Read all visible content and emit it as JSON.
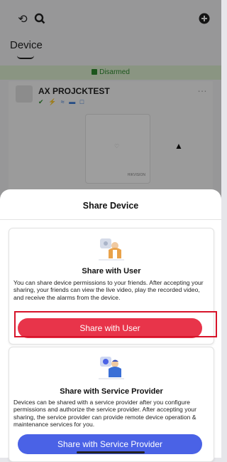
{
  "header": {
    "device_tab": "Device"
  },
  "arm_status": "Disarmed",
  "device": {
    "name": "AX PROJCKTEST",
    "brand": "HIKVISION"
  },
  "sheet": {
    "title": "Share Device",
    "user": {
      "title": "Share with User",
      "description": "You can share device permissions to your friends. After accepting your sharing, your friends can view the live video, play the recorded video, and receive the alarms from the device.",
      "button": "Share with User"
    },
    "provider": {
      "title": "Share with Service Provider",
      "description": "Devices can be shared with a service provider after you configure permissions and authorize the service provider. After accepting your sharing, the service provider can provide remote device operation & maintenance services for you.",
      "button": "Share with Service Provider"
    }
  },
  "colors": {
    "user_button": "#e8344a",
    "provider_button": "#4a62e6",
    "highlight": "#d7142a",
    "armed_green": "#2e8b2e"
  },
  "icons": [
    "history-icon",
    "search-icon",
    "add-icon",
    "lock-icon",
    "more-icon",
    "siren-icon",
    "share-user-illustration",
    "service-provider-illustration"
  ]
}
